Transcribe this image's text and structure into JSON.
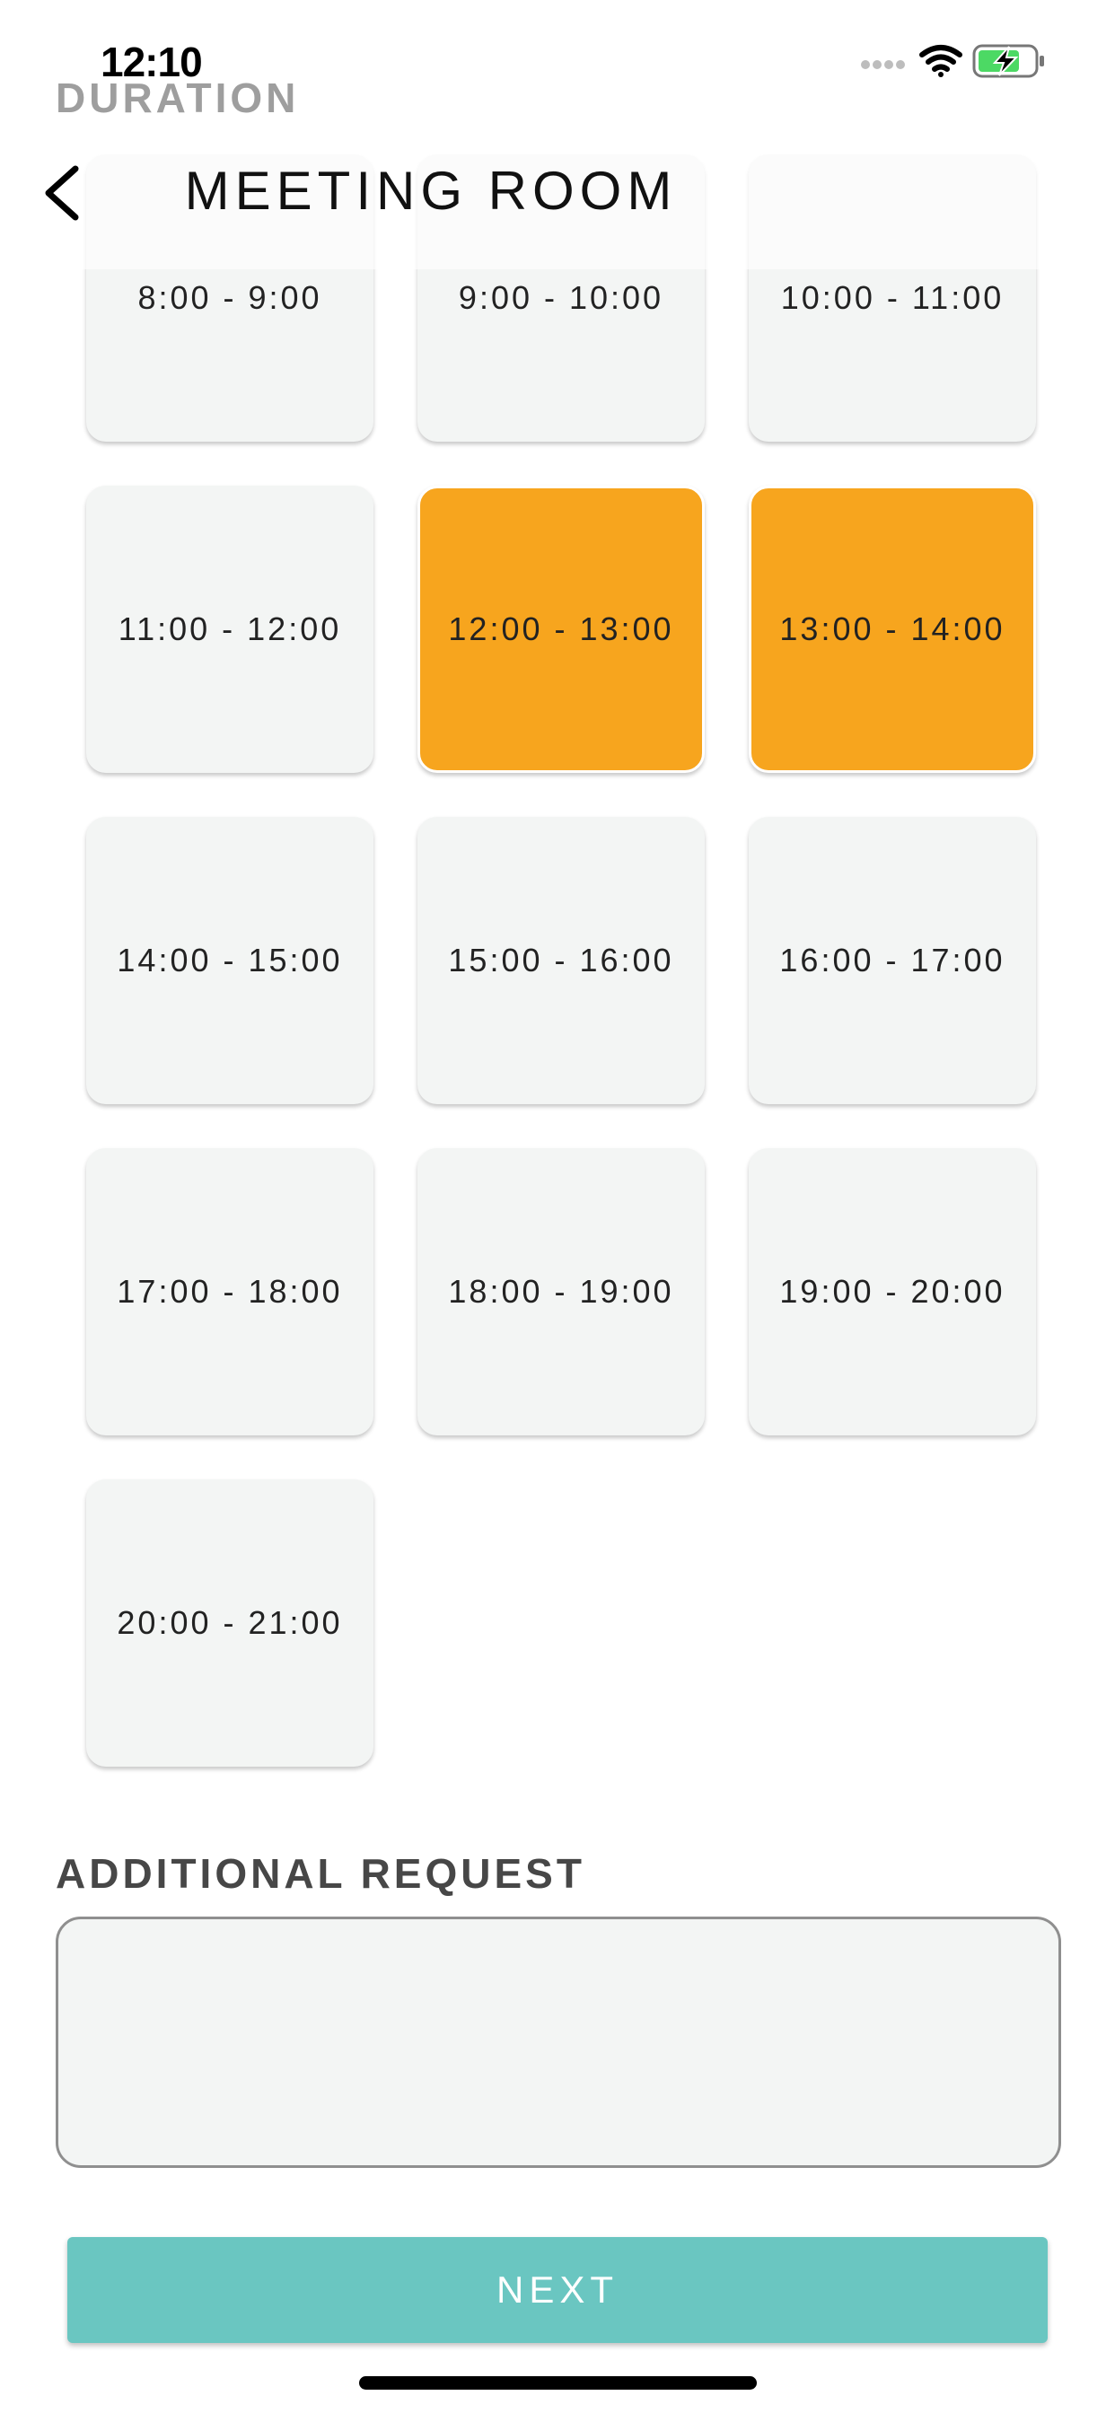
{
  "status_bar": {
    "time": "12:10",
    "icons": [
      "signal-dots-icon",
      "wifi-icon",
      "battery-charging-icon"
    ],
    "battery_color": "#4cd964"
  },
  "nav": {
    "title": "MEETING ROOM",
    "back_icon": "chevron-left-icon"
  },
  "duration": {
    "label": "DURATION",
    "slots": [
      {
        "label": "8:00 - 9:00",
        "selected": false
      },
      {
        "label": "9:00 - 10:00",
        "selected": false
      },
      {
        "label": "10:00 - 11:00",
        "selected": false
      },
      {
        "label": "11:00 - 12:00",
        "selected": false
      },
      {
        "label": "12:00 - 13:00",
        "selected": true
      },
      {
        "label": "13:00 - 14:00",
        "selected": true
      },
      {
        "label": "14:00 - 15:00",
        "selected": false
      },
      {
        "label": "15:00 - 16:00",
        "selected": false
      },
      {
        "label": "16:00 - 17:00",
        "selected": false
      },
      {
        "label": "17:00 - 18:00",
        "selected": false
      },
      {
        "label": "18:00 - 19:00",
        "selected": false
      },
      {
        "label": "19:00 - 20:00",
        "selected": false
      },
      {
        "label": "20:00 - 21:00",
        "selected": false
      }
    ]
  },
  "additional_request": {
    "label": "ADDITIONAL REQUEST",
    "value": "",
    "placeholder": ""
  },
  "next_button": {
    "label": "NEXT"
  },
  "colors": {
    "selected_slot": "#f7a51e",
    "slot_background": "#f3f5f4",
    "next_button": "#6ac6c1"
  }
}
